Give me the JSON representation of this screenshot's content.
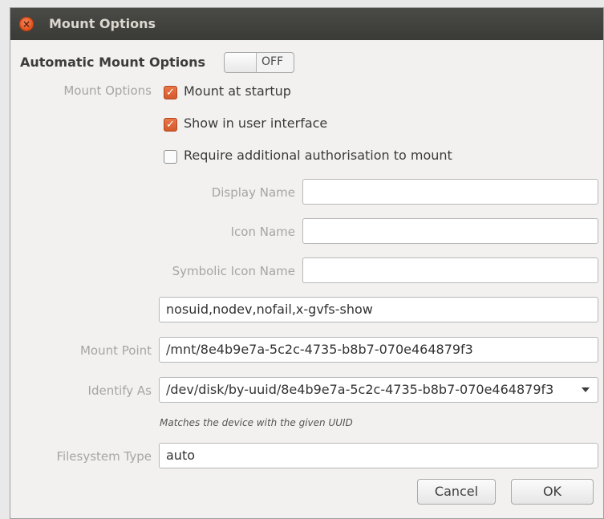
{
  "window": {
    "title": "Mount Options",
    "close_glyph": "×"
  },
  "automatic": {
    "label": "Automatic Mount Options",
    "toggle_state": "OFF"
  },
  "mount_options": {
    "label": "Mount Options",
    "checks": [
      {
        "label": "Mount at startup",
        "checked": true
      },
      {
        "label": "Show in user interface",
        "checked": true
      },
      {
        "label": "Require additional authorisation to mount",
        "checked": false
      }
    ]
  },
  "fields": {
    "display_name": {
      "label": "Display Name",
      "value": ""
    },
    "icon_name": {
      "label": "Icon Name",
      "value": ""
    },
    "symbolic_icon_name": {
      "label": "Symbolic Icon Name",
      "value": ""
    },
    "options_value": "nosuid,nodev,nofail,x-gvfs-show",
    "mount_point": {
      "label": "Mount Point",
      "value": "/mnt/8e4b9e7a-5c2c-4735-b8b7-070e464879f3"
    },
    "identify_as": {
      "label": "Identify As",
      "value": "/dev/disk/by-uuid/8e4b9e7a-5c2c-4735-b8b7-070e464879f3"
    },
    "identify_hint": "Matches the device with the given UUID",
    "filesystem_type": {
      "label": "Filesystem Type",
      "value": "auto"
    }
  },
  "buttons": {
    "cancel": "Cancel",
    "ok": "OK"
  },
  "colors": {
    "titlebar": "#3f3f3c",
    "accent_checkbox": "#dd6335",
    "close_button": "#e5531c"
  },
  "icons": {
    "close": "close-icon",
    "check": "check-icon",
    "dropdown": "chevron-down-icon"
  }
}
